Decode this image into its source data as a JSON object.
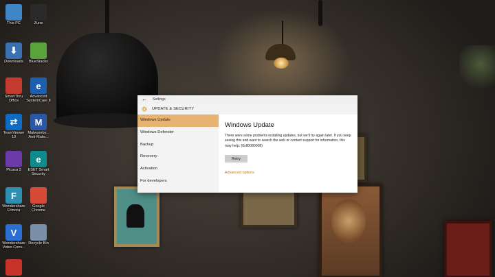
{
  "desktop": {
    "icons": [
      {
        "label": "This PC",
        "icon": "computer-icon",
        "glyph": "",
        "color": "#3f86c7"
      },
      {
        "label": "Zune",
        "icon": "zune-icon",
        "glyph": "",
        "color": "#2a2a2a"
      },
      {
        "label": "Downloads",
        "icon": "downloads-folder-icon",
        "glyph": "⬇",
        "color": "#3a6fb0"
      },
      {
        "label": "BlueStacks",
        "icon": "bluestacks-icon",
        "glyph": "",
        "color": "#5aa23a"
      },
      {
        "label": "SmartThru\nOffice",
        "icon": "smartthru-office-icon",
        "glyph": "",
        "color": "#c23b2e"
      },
      {
        "label": "Advanced\nSystemCare 8",
        "icon": "advanced-systemcare-icon",
        "glyph": "e",
        "color": "#1b5fae"
      },
      {
        "label": "TeamViewer\n10",
        "icon": "teamviewer-icon",
        "glyph": "⇄",
        "color": "#0e6cc4"
      },
      {
        "label": "Malwareby...\nAnti-Malw...",
        "icon": "malwarebytes-icon",
        "glyph": "M",
        "color": "#2b57a8"
      },
      {
        "label": "Picasa 3",
        "icon": "picasa-icon",
        "glyph": "",
        "color": "#6a3aa8"
      },
      {
        "label": "ESET Smart\nSecurity",
        "icon": "eset-icon",
        "glyph": "e",
        "color": "#0f8b8d"
      },
      {
        "label": "Wondershare\nFilmora",
        "icon": "filmora-icon",
        "glyph": "F",
        "color": "#2f8fb0"
      },
      {
        "label": "Google\nChrome",
        "icon": "chrome-icon",
        "glyph": "",
        "color": "#d84a38"
      },
      {
        "label": "Wondershare\nVideo Conv...",
        "icon": "video-converter-icon",
        "glyph": "V",
        "color": "#2a6fd1"
      },
      {
        "label": "Recycle Bin",
        "icon": "recycle-bin-icon",
        "glyph": "",
        "color": "#7a8fa8"
      },
      {
        "label": "",
        "icon": "app-shortcut-icon",
        "glyph": "",
        "color": "#c8322a"
      }
    ]
  },
  "settings": {
    "window_title": "Settings",
    "section_title": "UPDATE & SECURITY",
    "nav": [
      {
        "label": "Windows Update",
        "active": true
      },
      {
        "label": "Windows Defender",
        "active": false
      },
      {
        "label": "Backup",
        "active": false
      },
      {
        "label": "Recovery",
        "active": false
      },
      {
        "label": "Activation",
        "active": false
      },
      {
        "label": "For developers",
        "active": false
      }
    ],
    "content": {
      "title": "Windows Update",
      "message": "There were some problems installing updates, but we'll try again later. If you keep seeing this and want to search the web or contact support for information, this may help: (0x80080008)",
      "retry_label": "Retry",
      "advanced_link": "Advanced options"
    },
    "colors": {
      "accent": "#e8b371",
      "link": "#b57a1a"
    }
  }
}
